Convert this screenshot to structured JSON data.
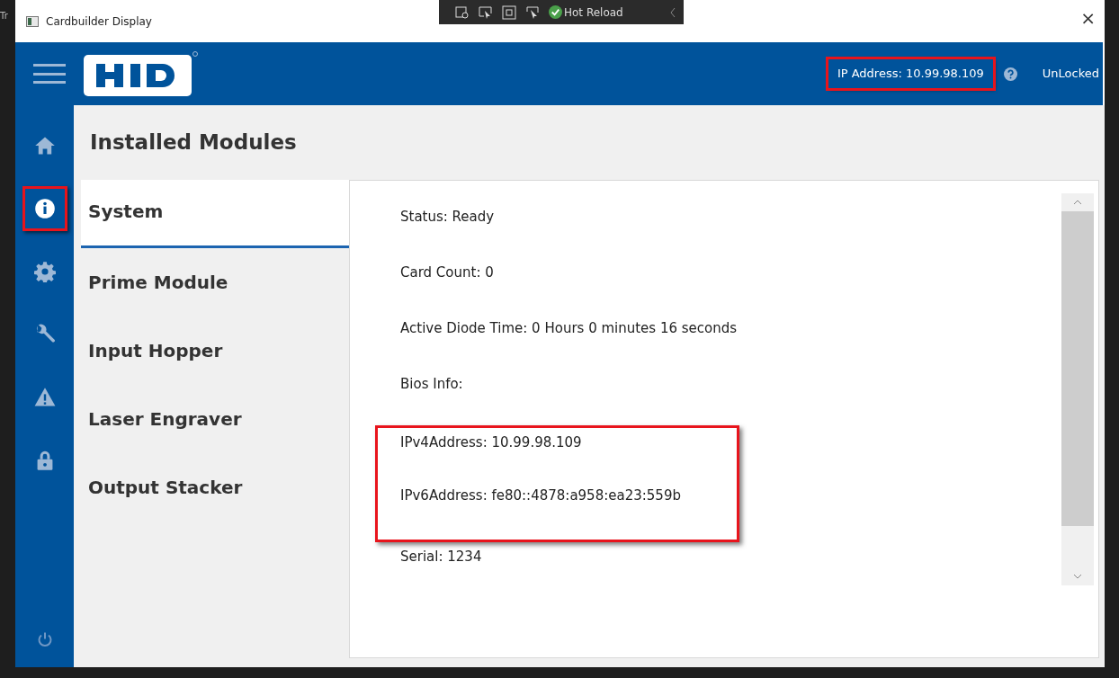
{
  "background_text": "Tr",
  "window": {
    "title": "Cardbuilder Display",
    "close": "×"
  },
  "debug_toolbar": {
    "label": "Hot Reload"
  },
  "header": {
    "ip_address": {
      "text": "IP Address: 10.99.98.109",
      "highlighted": true
    },
    "lock_status": "UnLocked"
  },
  "sidebar": {
    "items": [
      {
        "kind": "home",
        "selected": false,
        "highlighted": false
      },
      {
        "kind": "info",
        "selected": true,
        "highlighted": true
      },
      {
        "kind": "settings",
        "selected": false,
        "highlighted": false
      },
      {
        "kind": "tools",
        "selected": false,
        "highlighted": false
      },
      {
        "kind": "alerts",
        "selected": false,
        "highlighted": false
      },
      {
        "kind": "lock",
        "selected": false,
        "highlighted": false
      }
    ]
  },
  "page_title": "Installed Modules",
  "modules": [
    {
      "label": "System",
      "selected": true
    },
    {
      "label": "Prime Module",
      "selected": false
    },
    {
      "label": "Input Hopper",
      "selected": false
    },
    {
      "label": "Laser Engraver",
      "selected": false
    },
    {
      "label": "Output Stacker",
      "selected": false
    }
  ],
  "details": [
    {
      "text": "Status: Ready",
      "highlighted": false
    },
    {
      "text": "Card Count: 0",
      "highlighted": false
    },
    {
      "text": "Active Diode Time: 0 Hours 0 minutes 16 seconds",
      "highlighted": false
    },
    {
      "text": "Bios Info:",
      "highlighted": false
    },
    {
      "text": "IPv4Address: 10.99.98.109",
      "highlighted": true
    },
    {
      "text": "IPv6Address: fe80::4878:a958:ea23:559b",
      "highlighted": true
    },
    {
      "text": "Serial: 1234",
      "highlighted": false
    }
  ]
}
